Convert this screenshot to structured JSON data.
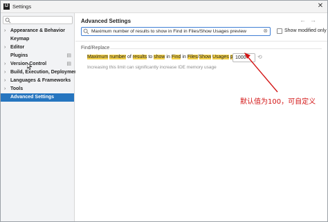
{
  "window": {
    "title": "Settings",
    "logo": "IJ"
  },
  "sidebar": {
    "search_placeholder": "",
    "items": [
      {
        "label": "Appearance & Behavior",
        "chevron": "›",
        "gear": false
      },
      {
        "label": "Keymap",
        "chevron": "",
        "gear": false
      },
      {
        "label": "Editor",
        "chevron": "›",
        "gear": false
      },
      {
        "label": "Plugins",
        "chevron": "",
        "gear": true
      },
      {
        "label": "Version Control",
        "chevron": "›",
        "gear": true
      },
      {
        "label": "Build, Execution, Deployment",
        "chevron": "›",
        "gear": false
      },
      {
        "label": "Languages & Frameworks",
        "chevron": "›",
        "gear": false
      },
      {
        "label": "Tools",
        "chevron": "›",
        "gear": false
      },
      {
        "label": "Advanced Settings",
        "chevron": "",
        "gear": false,
        "selected": true
      }
    ]
  },
  "main": {
    "title": "Advanced Settings",
    "back_arrow": "←",
    "forward_arrow": "→",
    "search_value": "Maximum number of results to show in Find in Files/Show Usages preview",
    "clear_icon": "⊗",
    "show_modified_label": "Show modified only",
    "group_title": "Find/Replace",
    "option": {
      "label_parts": [
        {
          "text": "Maximum",
          "hl": true
        },
        {
          "text": " ",
          "hl": false
        },
        {
          "text": "number",
          "hl": true
        },
        {
          "text": " of ",
          "hl": false
        },
        {
          "text": "results",
          "hl": true
        },
        {
          "text": " to ",
          "hl": false
        },
        {
          "text": "show",
          "hl": true
        },
        {
          "text": " in ",
          "hl": false
        },
        {
          "text": "Find",
          "hl": true
        },
        {
          "text": " in ",
          "hl": false
        },
        {
          "text": "Files",
          "hl": true
        },
        {
          "text": "/",
          "hl": false
        },
        {
          "text": "Show",
          "hl": true
        },
        {
          "text": " ",
          "hl": false
        },
        {
          "text": "Usages",
          "hl": true
        },
        {
          "text": " ",
          "hl": false
        },
        {
          "text": "preview",
          "hl": true
        }
      ],
      "value": "1000",
      "hint": "Increasing this limit can significantly increase IDE memory usage"
    }
  },
  "annotation": {
    "text": "默认值为100，可自定义",
    "color": "#d31515"
  },
  "colors": {
    "selection": "#2675bf",
    "highlight": "#f6d34a",
    "search_border": "#3d7dd4"
  }
}
